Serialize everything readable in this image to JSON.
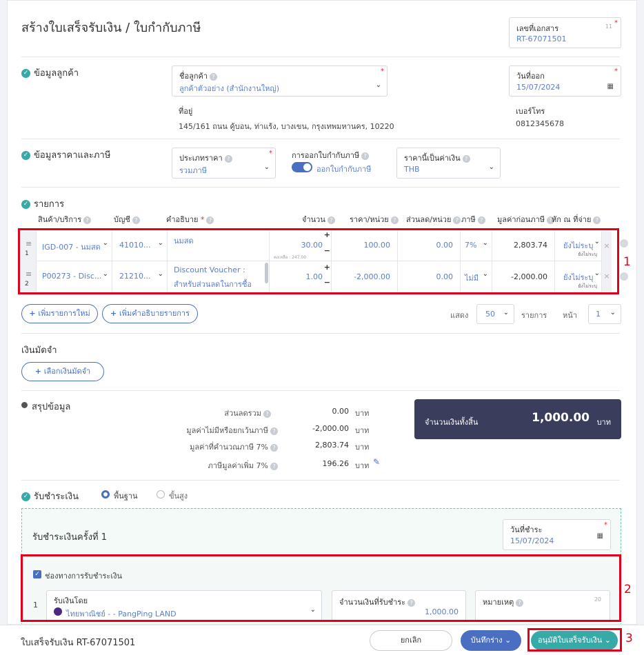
{
  "header": {
    "title": "สร้างใบเสร็จรับเงิน / ใบกำกับภาษี",
    "doc_label": "เลขที่เอกสาร",
    "doc_count": "11",
    "doc_value": "RT-67071501"
  },
  "customer": {
    "section": "ข้อมูลลูกค้า",
    "name_label": "ชื่อลูกค้า",
    "name_value": "ลูกค้าตัวอย่าง (สำนักงานใหญ่)",
    "date_label": "วันที่ออก",
    "date_value": "15/07/2024",
    "address_label": "ที่อยู่",
    "address_value": "145/161 ถนน คู้บอน, ท่าแร้ง, บางเขน, กรุงเทพมหานคร, 10220",
    "phone_label": "เบอร์โทร",
    "phone_value": "0812345678"
  },
  "pricing": {
    "section": "ข้อมูลราคาและภาษี",
    "price_type_label": "ประเภทราคา",
    "price_type_value": "รวมภาษี",
    "tax_invoice_label": "การออกใบกำกับภาษี",
    "tax_invoice_value": "ออกใบกำกับภาษี",
    "currency_label": "ราคานี้เป็นค่าเงิน",
    "currency_value": "THB"
  },
  "items": {
    "section": "รายการ",
    "headers": {
      "product": "สินค้า/บริการ",
      "account": "บัญชี",
      "desc": "คำอธิบาย",
      "qty": "จำนวน",
      "price": "ราคา/หน่วย",
      "discount": "ส่วนลด/หน่วย",
      "tax": "ภาษี",
      "pretax": "มูลค่าก่อนภาษี",
      "wht": "หัก ณ ที่จ่าย"
    },
    "rows": [
      {
        "no": "1",
        "product": "IGD-007 - นมสด",
        "account": "41010...",
        "desc": "นมสด",
        "desc2": "",
        "qty": "30.00",
        "stock": "คงเหลือ : 247.00",
        "price": "100.00",
        "discount": "0.00",
        "tax": "7%",
        "pretax": "2,803.74",
        "wht": "ยังไม่ระบุ",
        "wht_sub": "ยังไม่ระบุ"
      },
      {
        "no": "2",
        "product": "P00273 - Disc...",
        "account": "21210...",
        "desc": "Discount Voucher :",
        "desc2": "สำหรับส่วนลดในการซื้อ",
        "qty": "1.00",
        "stock": "",
        "price": "-2,000.00",
        "discount": "0.00",
        "tax": "ไม่มี",
        "pretax": "-2,000.00",
        "wht": "ยังไม่ระบุ",
        "wht_sub": "ยังไม่ระบุ"
      }
    ],
    "add_item": "เพิ่มรายการใหม่",
    "add_desc": "เพิ่มคำอธิบายรายการ",
    "show_label": "แสดง",
    "page_size": "50",
    "items_label": "รายการ",
    "page_label": "หน้า",
    "page_value": "1"
  },
  "deposit": {
    "section": "เงินมัดจำ",
    "button": "เลือกเงินมัดจำ"
  },
  "summary": {
    "section": "สรุปข้อมูล",
    "rows": [
      {
        "label": "ส่วนลดรวม",
        "value": "0.00",
        "unit": "บาท"
      },
      {
        "label": "มูลค่าไม่มีหรือยกเว้นภาษี",
        "value": "-2,000.00",
        "unit": "บาท"
      },
      {
        "label": "มูลค่าที่คำนวณภาษี 7%",
        "value": "2,803.74",
        "unit": "บาท"
      },
      {
        "label": "ภาษีมูลค่าเพิ่ม 7%",
        "value": "196.26",
        "unit": "บาท"
      }
    ],
    "total_label": "จำนวนเงินทั้งสิ้น",
    "total_value": "1,000.00",
    "total_unit": "บาท"
  },
  "payment": {
    "section": "รับชำระเงิน",
    "mode_basic": "พื้นฐาน",
    "mode_advanced": "ขั้นสูง",
    "round_title": "รับชำระเงินครั้งที่ 1",
    "pay_date_label": "วันที่ชำระ",
    "pay_date_value": "15/07/2024",
    "channel_label": "ช่องทางการรับชำระเงิน",
    "row_no": "1",
    "received_by_label": "รับเงินโดย",
    "received_by_value": "ไทยพาณิชย์ - - PangPing LAND",
    "amount_label": "จำนวนเงินที่รับชำระ",
    "amount_value": "1,000.00",
    "note_label": "หมายเหตุ",
    "note_count": "20"
  },
  "footer": {
    "doc_name": "ใบเสร็จรับเงิน RT-67071501",
    "cancel": "ยกเลิก",
    "save_draft": "บันทึกร่าง",
    "approve": "อนุมัติใบเสร็จรับเงิน"
  },
  "markers": {
    "m1": "1",
    "m2": "2",
    "m3": "3"
  },
  "colors": {
    "accent": "#37a9a6",
    "primary": "#4a6fc1",
    "dark_total": "#3a3d5c",
    "highlight": "#e0001a"
  }
}
